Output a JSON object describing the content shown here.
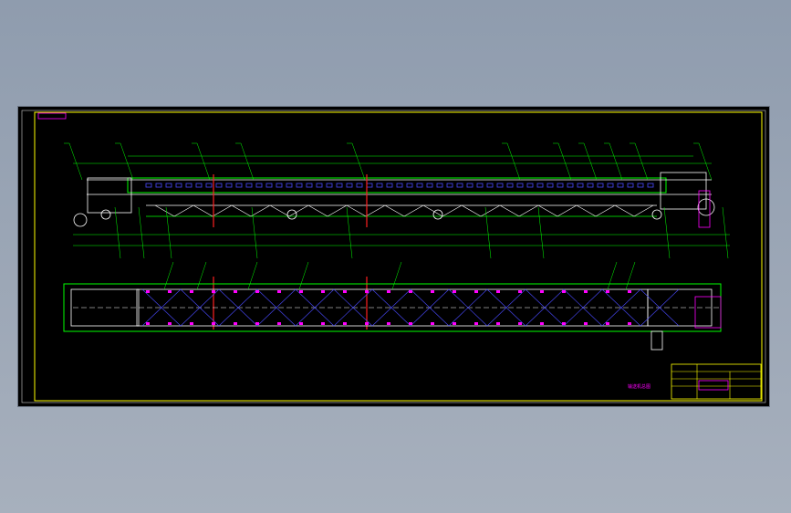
{
  "colors": {
    "background": "#8f9cae",
    "sheet": "#000000",
    "frame": "#ffff00",
    "outline": "#00ff00",
    "detail": "#ffffff",
    "bolts": "#4a4aff",
    "hatch": "#ff00ff",
    "cut_line": "#ff2020",
    "leader": "#00ffff"
  },
  "title_block": {
    "stamp": "输送机总图"
  }
}
